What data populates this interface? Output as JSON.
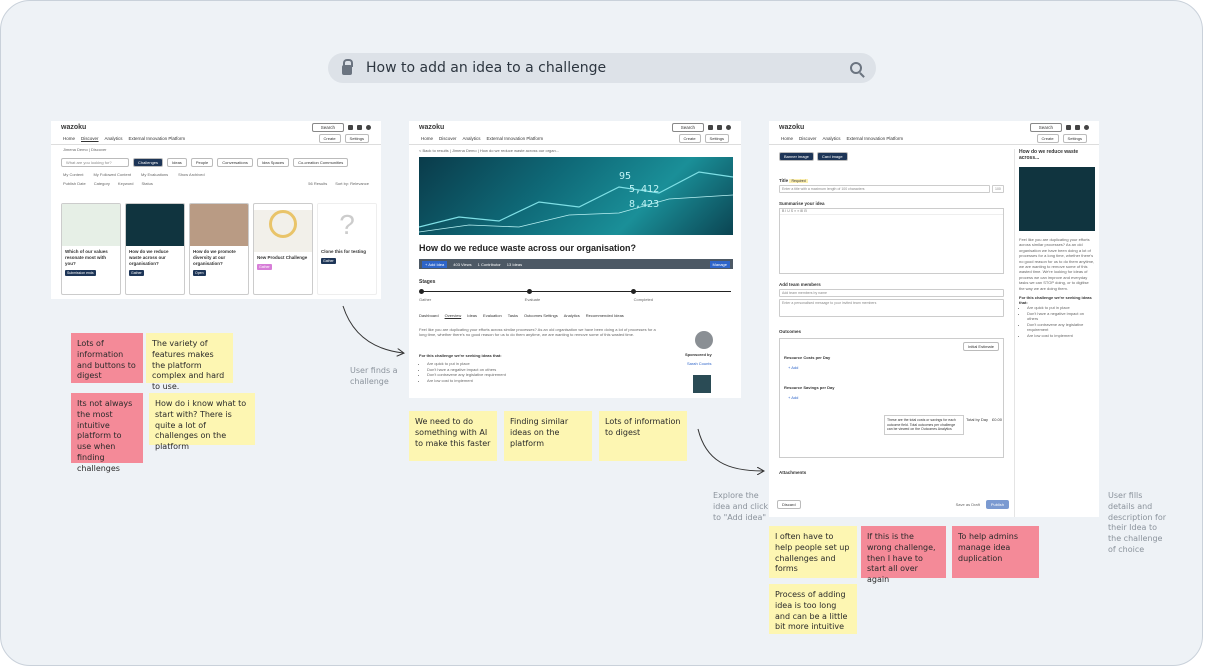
{
  "search": {
    "query": "How to add an idea to a challenge"
  },
  "screen1": {
    "logo": "wazoku",
    "search_btn": "Search",
    "nav": [
      "Home",
      "Discover",
      "Analytics",
      "External Innovation Platform"
    ],
    "create": "Create",
    "settings": "Settings",
    "breadcrumb": "Jimena Demo  |  Discover",
    "search_placeholder": "What are you looking for?",
    "filters": [
      "Challenges",
      "Ideas",
      "People",
      "Conversations",
      "Idea Spaces",
      "Co-creation Communities"
    ],
    "checks": [
      "My Content",
      "My Followed Content",
      "My Evaluations",
      "Show Archived"
    ],
    "dropdowns": [
      "Publish Date",
      "Category",
      "Keyword",
      "Status"
    ],
    "results": "56 Results",
    "sort": "Sort by: Relevance",
    "cards": [
      {
        "title": "Which of our values resonate most with you?",
        "tag": "Submission ends"
      },
      {
        "title": "How do we reduce waste across our organisation?",
        "tag": "Gather"
      },
      {
        "title": "How do we promote diversity at our organisation?",
        "tag": "Open"
      },
      {
        "title": "New Product Challenge",
        "tag": "Gather"
      },
      {
        "title": "Clone this for testing",
        "tag": "Gather"
      }
    ]
  },
  "screen2": {
    "logo": "wazoku",
    "search_btn": "Search",
    "nav": [
      "Home",
      "Discover",
      "Analytics",
      "External Innovation Platform"
    ],
    "create": "Create",
    "settings": "Settings",
    "breadcrumb": "< Back to results  |  Jimena Demo  |  How do we reduce waste across our organ...",
    "title": "How do we reduce waste across our organisation?",
    "add_idea": "+ Add Idea",
    "stats": [
      "403 Views",
      "1 Contributor",
      "13 Ideas"
    ],
    "manage": "Manage",
    "stages_label": "Stages",
    "stages": [
      "Gather",
      "Evaluate",
      "Completed"
    ],
    "tabs": [
      "Dashboard",
      "Overview",
      "Ideas",
      "Evaluation",
      "Tasks",
      "Outcomes Settings",
      "Analytics",
      "Recommended Ideas"
    ],
    "body": "Feel like you are duplicating your efforts across similar processes? As an old organisation we have been doing a lot of processes for a long time, whether there's no good reason for us to do them anytime, we are wanting to remove some of this wasted time.",
    "seeking": "For this challenge we're seeking ideas that:",
    "bullets": [
      "Are quick to put in place",
      "Don't have a negative impact on others",
      "Don't contravene any legislative requirement",
      "Are low cost to implement"
    ],
    "sponsored": "Sponsored by",
    "sponsor": "Sarah Counts"
  },
  "screen3": {
    "logo": "wazoku",
    "search_btn": "Search",
    "nav": [
      "Home",
      "Discover",
      "Analytics",
      "External Innovation Platform"
    ],
    "create": "Create",
    "settings": "Settings",
    "banner_btns": [
      "Banner image",
      "Card image"
    ],
    "title_label": "Title",
    "required": "Required",
    "title_placeholder": "Enter a title with a maximum length of 100 characters",
    "counter": "100",
    "summarise": "Summarise your idea",
    "team_label": "Add team members",
    "team_placeholder": "Add team members by name",
    "message_placeholder": "Enter a personalised message to your invited team members",
    "outcomes": "Outcomes",
    "estimate": "Initial Estimate",
    "cost_label": "Resource Costs per Day",
    "saving_label": "Resource Savings per Day",
    "add": "+ Add",
    "note": "These are the total costs or savings for each outcome field. Total outcomes per challenge can be viewed on the Outcomes Analytics",
    "total": "Total by Day",
    "total_value": "£0.00",
    "attachments": "Attachments",
    "discard": "Discard",
    "save_draft": "Save as Draft",
    "publish": "Publish",
    "side_title": "How do we reduce waste across...",
    "side_body": "Feel like you are duplicating your efforts across similar processes? As an old organisation we have been doing a lot of processes for a long time, whether there's no good reason for us to do them anytime, we are wanting to remove some of this wasted time. We're looking for ideas of process we can improve and everyday tasks we can STOP doing, or to digitise the way we are doing them.",
    "side_seeking": "For this challenge we're seeking ideas that:",
    "side_bullets": [
      "Are quick to put in place",
      "Don't have a negative impact on others",
      "Don't contravene any legislative requirement",
      "Are low cost to implement"
    ]
  },
  "notes": {
    "n1": "Lots of information and buttons to digest",
    "n2": "The variety of features makes the platform complex and hard to use.",
    "n3": "Its not always the most intuitive platform to use when finding challenges",
    "n4": "How do i know what to start with? There is quite a lot of challenges on the platform",
    "n5": "We need to do something with AI to make this faster",
    "n6": "Finding similar ideas on the platform",
    "n7": "Lots of information to digest",
    "n8": "I often have to help people set up challenges and forms",
    "n9": "If this is the wrong challenge, then I have to start all over again",
    "n10": "To help admins manage idea duplication",
    "n11": "Process of adding idea is too long and can be a little bit more intuitive"
  },
  "captions": {
    "c1": "User finds a challenge",
    "c2": "Explore the idea and click to \"Add idea\"",
    "c3": "User fills details and description for their Idea to the challenge of choice"
  },
  "colors": {
    "yellow_note": "#fdf6b2",
    "pink_note": "#f48a98",
    "teal_hero": "#0f6a78",
    "navy_btn": "#1d3557"
  }
}
